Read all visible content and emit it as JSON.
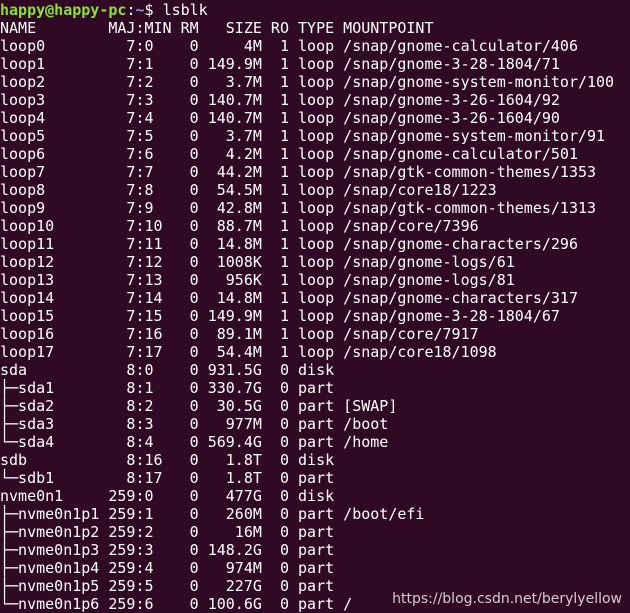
{
  "prompt": {
    "user_host": "happy@happy-pc",
    "separator": ":",
    "path": "~",
    "symbol": "$",
    "command": "lsblk"
  },
  "colors": {
    "background": "#300a24",
    "text": "#ffffff",
    "user_host": "#8ae234",
    "path": "#729fcf"
  },
  "header": "NAME        MAJ:MIN RM   SIZE RO TYPE MOUNTPOINT",
  "rows": [
    "loop0         7:0    0     4M  1 loop /snap/gnome-calculator/406",
    "loop1         7:1    0 149.9M  1 loop /snap/gnome-3-28-1804/71",
    "loop2         7:2    0   3.7M  1 loop /snap/gnome-system-monitor/100",
    "loop3         7:3    0 140.7M  1 loop /snap/gnome-3-26-1604/92",
    "loop4         7:4    0 140.7M  1 loop /snap/gnome-3-26-1604/90",
    "loop5         7:5    0   3.7M  1 loop /snap/gnome-system-monitor/91",
    "loop6         7:6    0   4.2M  1 loop /snap/gnome-calculator/501",
    "loop7         7:7    0  44.2M  1 loop /snap/gtk-common-themes/1353",
    "loop8         7:8    0  54.5M  1 loop /snap/core18/1223",
    "loop9         7:9    0  42.8M  1 loop /snap/gtk-common-themes/1313",
    "loop10        7:10   0  88.7M  1 loop /snap/core/7396",
    "loop11        7:11   0  14.8M  1 loop /snap/gnome-characters/296",
    "loop12        7:12   0  1008K  1 loop /snap/gnome-logs/61",
    "loop13        7:13   0   956K  1 loop /snap/gnome-logs/81",
    "loop14        7:14   0  14.8M  1 loop /snap/gnome-characters/317",
    "loop15        7:15   0 149.9M  1 loop /snap/gnome-3-28-1804/67",
    "loop16        7:16   0  89.1M  1 loop /snap/core/7917",
    "loop17        7:17   0  54.4M  1 loop /snap/core18/1098",
    "sda           8:0    0 931.5G  0 disk ",
    "├─sda1        8:1    0 330.7G  0 part ",
    "├─sda2        8:2    0  30.5G  0 part [SWAP]",
    "├─sda3        8:3    0   977M  0 part /boot",
    "└─sda4        8:4    0 569.4G  0 part /home",
    "sdb           8:16   0   1.8T  0 disk ",
    "└─sdb1        8:17   0   1.8T  0 part ",
    "nvme0n1     259:0    0   477G  0 disk ",
    "├─nvme0n1p1 259:1    0   260M  0 part /boot/efi",
    "├─nvme0n1p2 259:2    0    16M  0 part ",
    "├─nvme0n1p3 259:3    0 148.2G  0 part ",
    "├─nvme0n1p4 259:4    0   974M  0 part ",
    "├─nvme0n1p5 259:5    0   227G  0 part ",
    "└─nvme0n1p6 259:6    0 100.6G  0 part /"
  ],
  "watermark": "https://blog.csdn.net/berylyellow"
}
